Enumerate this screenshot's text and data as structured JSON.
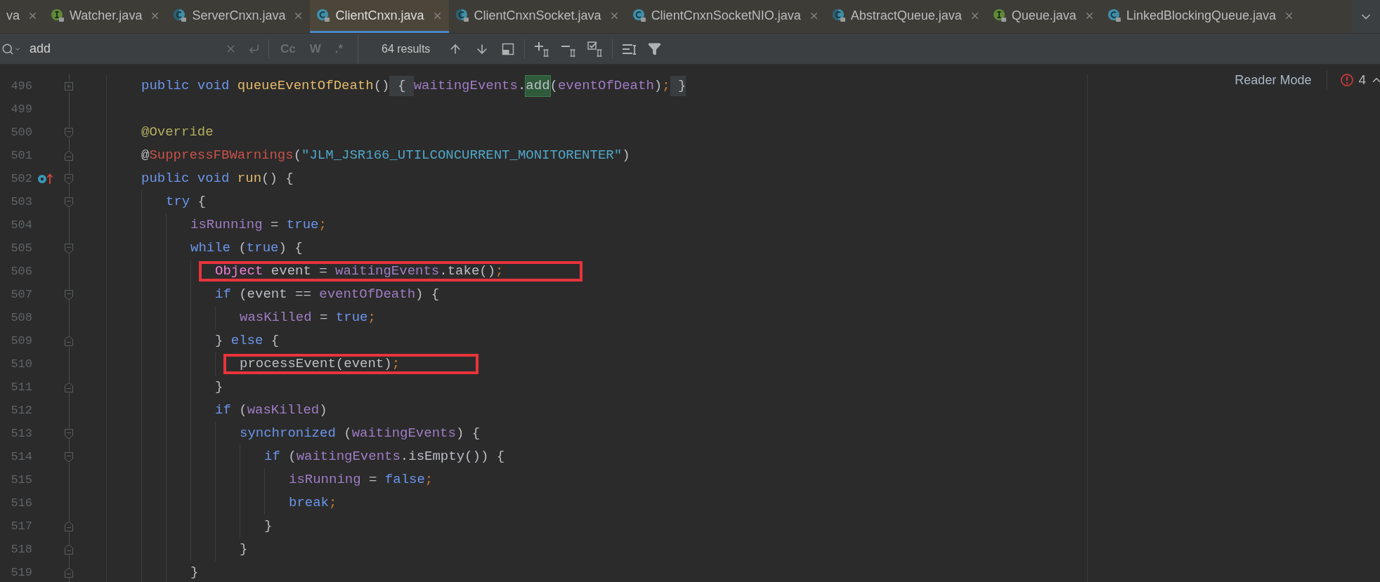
{
  "tabs": [
    {
      "label": "va",
      "kind": "none",
      "selected": false
    },
    {
      "label": "Watcher.java",
      "kind": "interface",
      "selected": false
    },
    {
      "label": "ServerCnxn.java",
      "kind": "abstract",
      "selected": false
    },
    {
      "label": "ClientCnxn.java",
      "kind": "class",
      "selected": true
    },
    {
      "label": "ClientCnxnSocket.java",
      "kind": "abstract",
      "selected": false
    },
    {
      "label": "ClientCnxnSocketNIO.java",
      "kind": "class",
      "selected": false
    },
    {
      "label": "AbstractQueue.java",
      "kind": "abstract",
      "selected": false
    },
    {
      "label": "Queue.java",
      "kind": "interface",
      "selected": false
    },
    {
      "label": "LinkedBlockingQueue.java",
      "kind": "class",
      "selected": false
    }
  ],
  "search": {
    "value": "add",
    "toggles": [
      {
        "label": "Cc",
        "selected": false
      },
      {
        "label": "W",
        "selected": false
      },
      {
        "label": ".*",
        "selected": false
      }
    ],
    "results": "64 results"
  },
  "reader_mode": "Reader Mode",
  "error_count": "4",
  "lines": [
    {
      "number": "496",
      "folded": true,
      "tokens": [
        {
          "text": "public void ",
          "kind": "kw"
        },
        {
          "text": "queueEventOfDeath",
          "kind": "fn"
        },
        {
          "text": "()",
          "kind": "p"
        },
        {
          "text": " { ",
          "kind": "fold"
        },
        {
          "text": "waitingEvents",
          "kind": "field"
        },
        {
          "text": ".",
          "kind": "p"
        },
        {
          "text": "add",
          "kind": "match"
        },
        {
          "text": "(",
          "kind": "p"
        },
        {
          "text": "eventOfDeath",
          "kind": "field"
        },
        {
          "text": ")",
          "kind": "p"
        },
        {
          "text": ";",
          "kind": "semi"
        },
        {
          "text": " }",
          "kind": "fold"
        }
      ]
    },
    {
      "number": "499"
    },
    {
      "number": "500",
      "fold_start": true,
      "tokens": [
        {
          "text": "@Override",
          "kind": "ann"
        }
      ]
    },
    {
      "number": "501",
      "fold_end": true,
      "tokens": [
        {
          "text": "@",
          "kind": "p"
        },
        {
          "text": "SuppressFBWarnings",
          "kind": "ann2"
        },
        {
          "text": "(",
          "kind": "p"
        },
        {
          "text": "\"JLM_JSR166_UTILCONCURRENT_MONITORENTER\"",
          "kind": "str"
        },
        {
          "text": ")",
          "kind": "p"
        }
      ]
    },
    {
      "number": "502",
      "fold_start": true,
      "overrides": true,
      "tokens": [
        {
          "text": "public void ",
          "kind": "kw"
        },
        {
          "text": "run",
          "kind": "fn"
        },
        {
          "text": "() {",
          "kind": "p"
        }
      ],
      "children": [
        {
          "number": "503",
          "fold_start": true,
          "tokens": [
            {
              "text": "try",
              "kind": "kw"
            },
            {
              "text": " {",
              "kind": "p"
            }
          ],
          "children": [
            {
              "number": "504",
              "tokens": [
                {
                  "text": "isRunning",
                  "kind": "field"
                },
                {
                  "text": " = ",
                  "kind": "p"
                },
                {
                  "text": "true",
                  "kind": "kw"
                },
                {
                  "text": ";",
                  "kind": "semi"
                }
              ]
            },
            {
              "number": "505",
              "fold_start": true,
              "tokens": [
                {
                  "text": "while",
                  "kind": "kw"
                },
                {
                  "text": " (",
                  "kind": "p"
                },
                {
                  "text": "true",
                  "kind": "kw"
                },
                {
                  "text": ") {",
                  "kind": "p"
                }
              ],
              "children": [
                {
                  "number": "506",
                  "boxed": true,
                  "tokens": [
                    {
                      "text": "Object",
                      "kind": "type"
                    },
                    {
                      "text": " event = ",
                      "kind": "p"
                    },
                    {
                      "text": "waitingEvents",
                      "kind": "field"
                    },
                    {
                      "text": ".take()",
                      "kind": "p"
                    },
                    {
                      "text": ";",
                      "kind": "semi"
                    }
                  ]
                },
                {
                  "number": "507",
                  "fold_start": true,
                  "tokens": [
                    {
                      "text": "if",
                      "kind": "kw"
                    },
                    {
                      "text": " (event == ",
                      "kind": "p"
                    },
                    {
                      "text": "eventOfDeath",
                      "kind": "field"
                    },
                    {
                      "text": ") {",
                      "kind": "p"
                    }
                  ],
                  "children": [
                    {
                      "number": "508",
                      "tokens": [
                        {
                          "text": "wasKilled",
                          "kind": "field"
                        },
                        {
                          "text": " = ",
                          "kind": "p"
                        },
                        {
                          "text": "true",
                          "kind": "kw"
                        },
                        {
                          "text": ";",
                          "kind": "semi"
                        }
                      ]
                    }
                  ]
                },
                {
                  "number": "509",
                  "fold_end": true,
                  "tokens": [
                    {
                      "text": "} ",
                      "kind": "p"
                    },
                    {
                      "text": "else",
                      "kind": "kw"
                    },
                    {
                      "text": " {",
                      "kind": "p"
                    }
                  ],
                  "children": [
                    {
                      "number": "510",
                      "boxed": true,
                      "tokens": [
                        {
                          "text": "processEvent(event)",
                          "kind": "p"
                        },
                        {
                          "text": ";",
                          "kind": "semi"
                        }
                      ]
                    }
                  ]
                },
                {
                  "number": "511",
                  "fold_end": true,
                  "tokens": [
                    {
                      "text": "}",
                      "kind": "p"
                    }
                  ]
                },
                {
                  "number": "512",
                  "tokens": [
                    {
                      "text": "if",
                      "kind": "kw"
                    },
                    {
                      "text": " (",
                      "kind": "p"
                    },
                    {
                      "text": "wasKilled",
                      "kind": "field"
                    },
                    {
                      "text": ")",
                      "kind": "p"
                    }
                  ],
                  "children": [
                    {
                      "number": "513",
                      "fold_start": true,
                      "tokens": [
                        {
                          "text": "synchronized",
                          "kind": "kw"
                        },
                        {
                          "text": " (",
                          "kind": "p"
                        },
                        {
                          "text": "waitingEvents",
                          "kind": "field"
                        },
                        {
                          "text": ") {",
                          "kind": "p"
                        }
                      ],
                      "children": [
                        {
                          "number": "514",
                          "fold_start": true,
                          "tokens": [
                            {
                              "text": "if",
                              "kind": "kw"
                            },
                            {
                              "text": " (",
                              "kind": "p"
                            },
                            {
                              "text": "waitingEvents",
                              "kind": "field"
                            },
                            {
                              "text": ".isEmpty()) {",
                              "kind": "p"
                            }
                          ],
                          "children": [
                            {
                              "number": "515",
                              "tokens": [
                                {
                                  "text": "isRunning",
                                  "kind": "field"
                                },
                                {
                                  "text": " = ",
                                  "kind": "p"
                                },
                                {
                                  "text": "false",
                                  "kind": "kw"
                                },
                                {
                                  "text": ";",
                                  "kind": "semi"
                                }
                              ]
                            },
                            {
                              "number": "516",
                              "tokens": [
                                {
                                  "text": "break",
                                  "kind": "kw"
                                },
                                {
                                  "text": ";",
                                  "kind": "semi"
                                }
                              ]
                            }
                          ]
                        },
                        {
                          "number": "517",
                          "fold_end": true,
                          "tokens": [
                            {
                              "text": "}",
                              "kind": "p"
                            }
                          ]
                        }
                      ]
                    },
                    {
                      "number": "518",
                      "fold_end": true,
                      "tokens": [
                        {
                          "text": "}",
                          "kind": "p"
                        }
                      ]
                    }
                  ]
                }
              ]
            },
            {
              "number": "519",
              "fold_end": true,
              "tokens": [
                {
                  "text": "}",
                  "kind": "p"
                }
              ]
            }
          ]
        }
      ]
    }
  ]
}
